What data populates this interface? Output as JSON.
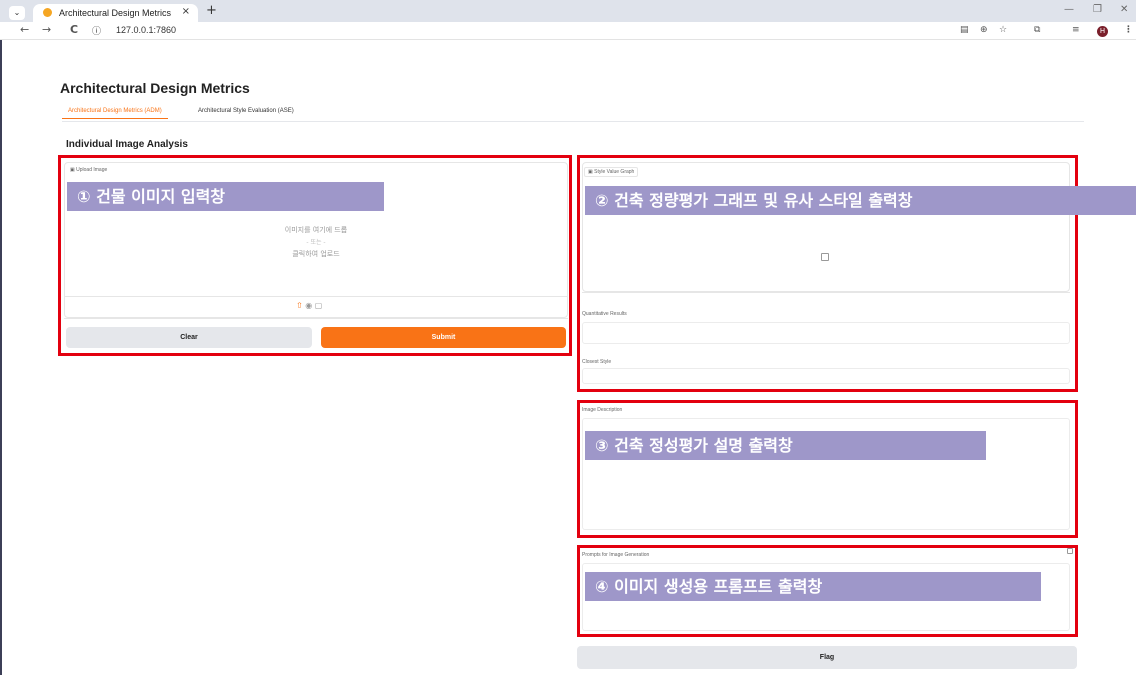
{
  "browser": {
    "tab_title": "Architectural Design Metrics",
    "tab_close": "×",
    "new_tab": "+",
    "url": "127.0.0.1:7860",
    "info_icon": "ⓘ",
    "back": "←",
    "forward": "→",
    "reload": "C",
    "minimize": "—",
    "restore": "❐",
    "close": "✕",
    "avatar_letter": "H",
    "menu_dots": "⋮",
    "menu_chevron": "⌄"
  },
  "app": {
    "title": "Architectural Design Metrics",
    "tabs": [
      {
        "label": "Architectural Design Metrics (ADM)"
      },
      {
        "label": "Architectural Style Evaluation (ASE)"
      }
    ],
    "section_title": "Individual Image Analysis"
  },
  "upload": {
    "label": "Upload Image",
    "drop_text": "이미지를 여기에 드롭",
    "or_text": "- 또는 -",
    "click_text": "클릭하여 업로드",
    "clear_label": "Clear",
    "submit_label": "Submit"
  },
  "outputs": {
    "graph_label": "Style Value Graph",
    "quant_label": "Quantitative Results",
    "closest_label": "Closest Style",
    "desc_label": "Image Description",
    "prompts_label": "Prompts for Image Generation",
    "flag_label": "Flag"
  },
  "annotations": {
    "a1": "① 건물 이미지 입력창",
    "a2": "② 건축 정량평가 그래프 및 유사 스타일 출력창",
    "a3": "③ 건축 정성평가 설명 출력창",
    "a4": "④ 이미지 생성용 프롬프트 출력창"
  },
  "colors": {
    "accent": "#f97316",
    "annotation_box": "#e3000f",
    "annotation_banner": "#9e97c9"
  }
}
